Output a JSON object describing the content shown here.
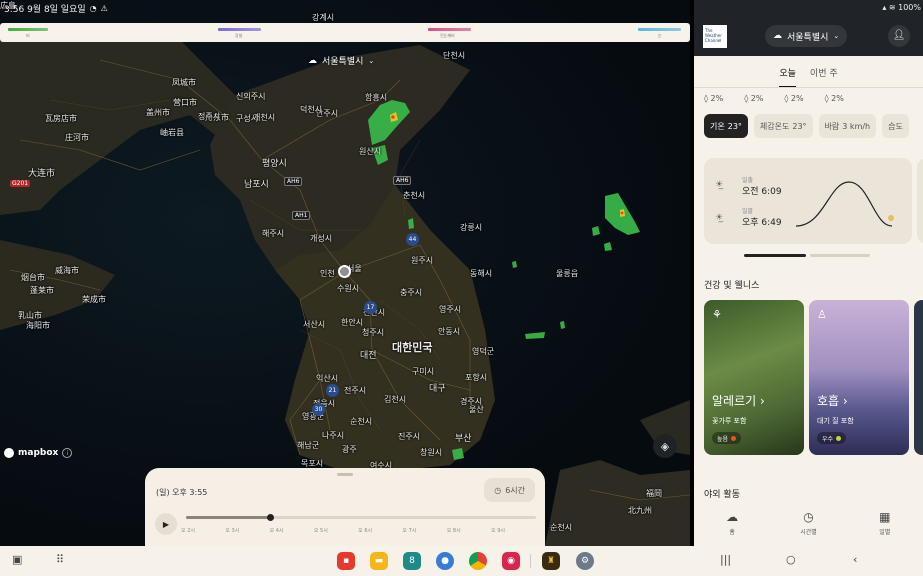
{
  "status_bar": {
    "left_text": "3:56  9월 8일 일요일",
    "right_text": "100%"
  },
  "legend": {
    "labels": [
      "비",
      "강설",
      "진눈깨비",
      "눈"
    ],
    "colors": [
      "#3fae3f",
      "#7b68d8",
      "#d94d8a",
      "#5ab8d8"
    ]
  },
  "map": {
    "location_label": "서울특별시",
    "mapbox_label": "mapbox",
    "labels": [
      {
        "t": "강계시",
        "c": "map-label"
      },
      {
        "t": "혜산시",
        "c": "map-label"
      },
      {
        "t": "단천시",
        "c": "map-label"
      },
      {
        "t": "함흥시",
        "c": "map-label"
      },
      {
        "t": "원산시",
        "c": "map-label"
      },
      {
        "t": "평양시",
        "c": "map-label mid"
      },
      {
        "t": "남포시",
        "c": "map-label mid"
      },
      {
        "t": "해주시",
        "c": "map-label"
      },
      {
        "t": "개성시",
        "c": "map-label"
      },
      {
        "t": "인천",
        "c": "map-label"
      },
      {
        "t": "서울",
        "c": "map-label"
      },
      {
        "t": "수원시",
        "c": "map-label"
      },
      {
        "t": "대한민국",
        "c": "map-label big"
      },
      {
        "t": "대전",
        "c": "map-label mid"
      },
      {
        "t": "대구",
        "c": "map-label mid"
      },
      {
        "t": "부산",
        "c": "map-label mid"
      },
      {
        "t": "광주",
        "c": "map-label"
      },
      {
        "t": "울산",
        "c": "map-label"
      },
      {
        "t": "포항시",
        "c": "map-label"
      },
      {
        "t": "진주시",
        "c": "map-label"
      },
      {
        "t": "목포시",
        "c": "map-label"
      },
      {
        "t": "여수시",
        "c": "map-label"
      },
      {
        "t": "구미시",
        "c": "map-label"
      },
      {
        "t": "전주시",
        "c": "map-label"
      },
      {
        "t": "청주시",
        "c": "map-label"
      },
      {
        "t": "천안시",
        "c": "map-label"
      },
      {
        "t": "서산시",
        "c": "map-label"
      },
      {
        "t": "한안시",
        "c": "map-label"
      },
      {
        "t": "충주시",
        "c": "map-label"
      },
      {
        "t": "원주시",
        "c": "map-label"
      },
      {
        "t": "춘천시",
        "c": "map-label"
      },
      {
        "t": "강릉시",
        "c": "map-label"
      },
      {
        "t": "동해시",
        "c": "map-label"
      },
      {
        "t": "안동시",
        "c": "map-label"
      },
      {
        "t": "영덕군",
        "c": "map-label"
      },
      {
        "t": "울릉읍",
        "c": "map-label"
      },
      {
        "t": "영주시",
        "c": "map-label"
      },
      {
        "t": "익산시",
        "c": "map-label"
      },
      {
        "t": "김천시",
        "c": "map-label"
      },
      {
        "t": "경주시",
        "c": "map-label"
      },
      {
        "t": "창원시",
        "c": "map-label"
      },
      {
        "t": "순천시",
        "c": "map-label"
      },
      {
        "t": "나주시",
        "c": "map-label"
      },
      {
        "t": "정읍시",
        "c": "map-label"
      },
      {
        "t": "영광군",
        "c": "map-label"
      },
      {
        "t": "해남군",
        "c": "map-label"
      },
      {
        "t": "大连市",
        "c": "map-label mid"
      },
      {
        "t": "威海市",
        "c": "map-label"
      },
      {
        "t": "烟台市",
        "c": "map-label"
      },
      {
        "t": "丹东市",
        "c": "map-label"
      },
      {
        "t": "瓦房店市",
        "c": "map-label"
      },
      {
        "t": "庄河市",
        "c": "map-label"
      },
      {
        "t": "盖州市",
        "c": "map-label"
      },
      {
        "t": "营口市",
        "c": "map-label"
      },
      {
        "t": "岫岩县",
        "c": "map-label"
      },
      {
        "t": "凤城市",
        "c": "map-label"
      },
      {
        "t": "荣成市",
        "c": "map-label"
      },
      {
        "t": "乳山市",
        "c": "map-label"
      },
      {
        "t": "海阳市",
        "c": "map-label"
      },
      {
        "t": "蓬莱市",
        "c": "map-label"
      },
      {
        "t": "신의주시",
        "c": "map-label"
      },
      {
        "t": "구성시",
        "c": "map-label"
      },
      {
        "t": "정주시",
        "c": "map-label"
      },
      {
        "t": "안주시",
        "c": "map-label"
      },
      {
        "t": "개천시",
        "c": "map-label"
      },
      {
        "t": "덕천시",
        "c": "map-label"
      },
      {
        "t": "순천시",
        "c": "map-label"
      },
      {
        "t": "北九州",
        "c": "map-label"
      },
      {
        "t": "福岡",
        "c": "map-label"
      },
      {
        "t": "広島",
        "c": "map-label"
      }
    ],
    "shields": [
      "G201",
      "AH6",
      "AH6",
      "AH1",
      "44",
      "17",
      "21",
      "30"
    ]
  },
  "timeline": {
    "current_time": "(일) 오후 3:55",
    "range_label": "6시간",
    "progress": 0.24,
    "ticks": [
      "오 2시",
      "오 3시",
      "오 4시",
      "오 5시",
      "오 6시",
      "오 7시",
      "오 8시",
      "오 9시"
    ]
  },
  "weather": {
    "brand": "The Weather Channel",
    "city": "서울특별시",
    "tabs": [
      "오늘",
      "이번 주"
    ],
    "precip": [
      "2%",
      "2%",
      "2%",
      "2%"
    ],
    "metrics": [
      {
        "label": "기온",
        "value": "23°",
        "active": true
      },
      {
        "label": "체감온도",
        "value": "23°",
        "active": false
      },
      {
        "label": "바람",
        "value": "3 km/h",
        "active": false
      },
      {
        "label": "습도",
        "value": "",
        "active": false
      }
    ],
    "sunrise_label": "일출",
    "sunrise_time": "오전 6:09",
    "sunset_label": "일몰",
    "sunset_time": "오후 6:49",
    "health_title": "건강 및 웰니스",
    "health_cards": [
      {
        "title": "알레르기 ›",
        "sub": "꽃가루 포함",
        "badge": "높음",
        "badge_color": "#e5542f"
      },
      {
        "title": "호흡 ›",
        "sub": "대기 질 포함",
        "badge": "우수",
        "badge_color": "#c7d33a"
      }
    ],
    "outdoor_title": "야외 활동",
    "nav": [
      "홈",
      "시간별",
      "일별"
    ]
  }
}
